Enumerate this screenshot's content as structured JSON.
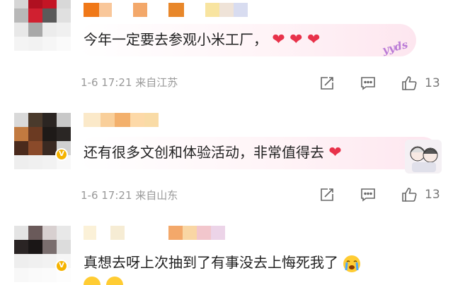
{
  "comments": [
    {
      "text": "今年一定要去参观小米工厂，",
      "emojis": [
        "❤",
        "❤",
        "❤"
      ],
      "sticker_text": "yyds",
      "timestamp": "1-6 17:21",
      "source": "来自江苏",
      "like_count": "13"
    },
    {
      "text": "还有很多文创和体验活动，非常值得去",
      "emojis": [
        "❤"
      ],
      "timestamp": "1-6 17:21",
      "source": "来自山东",
      "like_count": "13"
    },
    {
      "text": "真想去呀上次抽到了有事没去上悔死我了",
      "emojis": [
        "crying-face"
      ]
    }
  ],
  "icons": {
    "share": "share-icon",
    "reply": "comment-icon",
    "like": "thumbs-up-icon",
    "verified": "verified-badge-icon"
  },
  "colors": {
    "heart": "#e8324a",
    "meta_text": "#999999",
    "icon_stroke": "#666666",
    "verified_badge": "#f5b300",
    "bubble_tint": "#fde6ef"
  }
}
